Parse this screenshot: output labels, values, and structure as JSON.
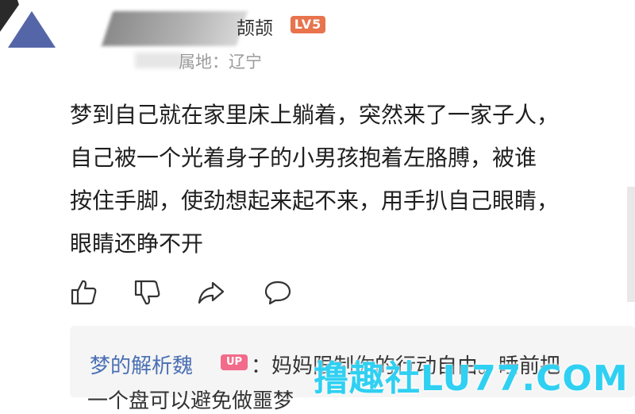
{
  "header": {
    "username": "颉颉",
    "level_badge": "LV5",
    "location": "属地：辽宁"
  },
  "comment": {
    "text": "梦到自己就在家里床上躺着，突然来了一家子人，\n自己被一个光着身子的小男孩抱着左胳膊，被谁\n按住手脚，使劲想起来起不来，用手扒自己眼睛，\n眼睛还睁不开"
  },
  "actions": {
    "like": "thumbs-up-icon",
    "dislike": "thumbs-down-icon",
    "share": "share-icon",
    "reply": "comment-icon"
  },
  "reply": {
    "author": "梦的解析魏",
    "badge": "UP",
    "text": "：妈妈限制你的行动自由。睡前把",
    "text_line2": "一个盘可以避免做噩梦"
  },
  "watermark": "撸趣社LU77.COM",
  "colors": {
    "level_badge": "#e8734c",
    "up_badge": "#f26b8a",
    "author_link": "#4a6fb3",
    "watermark": "#2fd0f2"
  }
}
